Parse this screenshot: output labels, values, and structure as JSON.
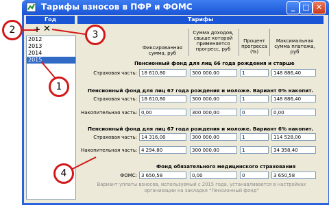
{
  "window": {
    "title": "Тарифы взносов в ПФР и ФОМС",
    "colors": {
      "titlebar": "#1a55d6",
      "face": "#ece9d8",
      "callout": "#d21818",
      "selection": "#316ac5"
    }
  },
  "left_panel": {
    "header": "Год",
    "add_icon": "plus-icon",
    "remove_icon": "x-icon",
    "years": [
      "2012",
      "2013",
      "2014",
      "2015"
    ],
    "selected_year": "2015"
  },
  "main_panel": {
    "header": "Тарифы",
    "columns": [
      "Фиксированная сумма, руб",
      "Сумма доходов, свыше которой применяется прогресс, руб",
      "Процент прогресса (%)",
      "Максимальная сумма платежа, руб"
    ],
    "sections": [
      {
        "title": "Пенсионный фонд для лиц 66 года рождения и старше",
        "rows": [
          {
            "label": "Страховая часть:",
            "values": [
              "18 610,80",
              "300 000,00",
              "1",
              "148 886,40"
            ]
          }
        ]
      },
      {
        "title": "Пенсионный фонд для лиц 67 года рождения и моложе. Вариант 0% накопит.",
        "rows": [
          {
            "label": "Страховая часть:",
            "values": [
              "18 610,80",
              "300 000,00",
              "1",
              "148 886,40"
            ]
          },
          {
            "label": "Накопительная часть:",
            "values": [
              "0,00",
              "300 000,00",
              "0",
              "0,00"
            ]
          }
        ]
      },
      {
        "title": "Пенсионный фонд для лиц 67 года рождения и моложе. Вариант 6% накопит.",
        "rows": [
          {
            "label": "Страховая часть:",
            "values": [
              "14 316,00",
              "300 000,00",
              "1",
              "114 528,00"
            ]
          },
          {
            "label": "Накопительная часть:",
            "values": [
              "4 294,80",
              "300 000,00",
              "1",
              "34 358,40"
            ]
          }
        ]
      }
    ],
    "foms": {
      "title": "Фонд обязательного медицинского страхования",
      "label": "ФОМС:",
      "values": [
        "3 650,58",
        "0,00",
        "0",
        "3 650,58"
      ]
    },
    "note": "Вариант уплаты взносов, используемый с 2015 года, устанавливается в настройках организации на закладке \"Пенсионный фонд\""
  },
  "callouts": [
    "1",
    "2",
    "3",
    "4"
  ]
}
